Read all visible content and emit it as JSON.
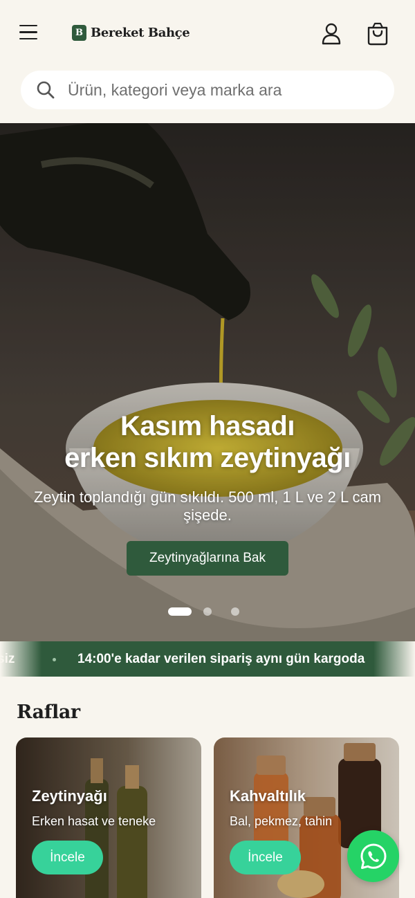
{
  "header": {
    "brand_initial": "B",
    "brand_name": "Bereket Bahçe",
    "icons": [
      "menu-icon",
      "user-icon",
      "shopping-bag-icon"
    ]
  },
  "search": {
    "placeholder": "Ürün, kategori veya marka ara",
    "value": ""
  },
  "hero": {
    "title_line1": "Kasım hasadı",
    "title_line2": "erken sıkım zeytinyağı",
    "subtitle": "Zeytin toplandığı gün sıkıldı. 500 ml, 1 L ve 2 L cam şişede.",
    "cta_label": "Zeytinyağlarına Bak",
    "slides_total": 3,
    "active_slide": 1
  },
  "marquee": {
    "text_partial": "siz",
    "text_main": "14:00'e kadar verilen sipariş aynı gün kargoda"
  },
  "shelves": {
    "title": "Raflar",
    "cards": [
      {
        "title": "Zeytinyağı",
        "subtitle": "Erken hasat ve teneke",
        "button": "İncele"
      },
      {
        "title": "Kahvaltılık",
        "subtitle": "Bal, pekmez, tahin",
        "button": "İncele"
      }
    ]
  },
  "colors": {
    "background": "#f8f5ee",
    "brand_green": "#2f5a3c",
    "cta_mint": "#37d29a",
    "whatsapp": "#25d366"
  }
}
